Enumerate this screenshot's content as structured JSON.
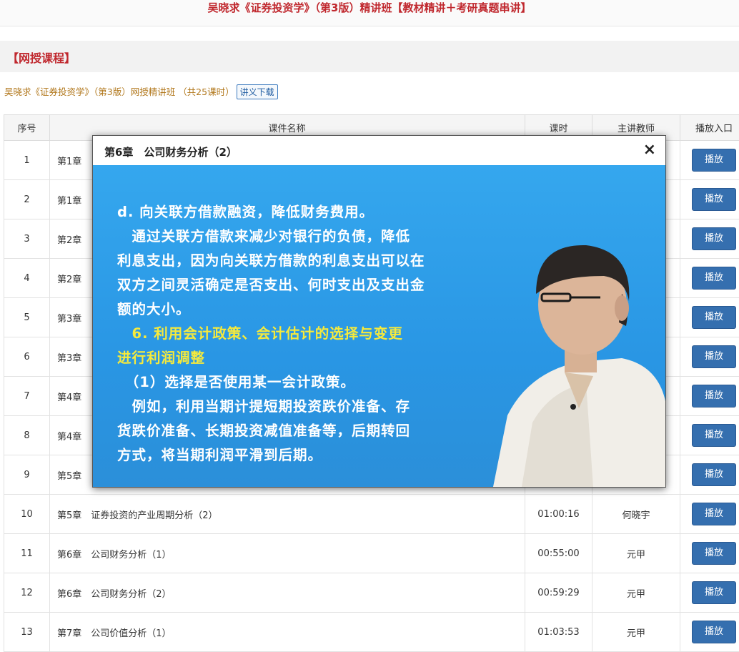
{
  "header": {
    "title": "吴晓求《证券投资学》（第3版）精讲班【教材精讲＋考研真题串讲】"
  },
  "section": {
    "title": "【网授课程】"
  },
  "course": {
    "line": "吴晓求《证券投资学》（第3版）网授精讲班 （共25课时）",
    "download_label": "讲义下载"
  },
  "table": {
    "headers": [
      "序号",
      "课件名称",
      "课时",
      "主讲教师",
      "播放入口"
    ],
    "play_label": "播放",
    "rows": [
      {
        "num": "1",
        "chapter": "第1章",
        "title": "",
        "duration": "",
        "teacher": ""
      },
      {
        "num": "2",
        "chapter": "第1章",
        "title": "",
        "duration": "",
        "teacher": ""
      },
      {
        "num": "3",
        "chapter": "第2章",
        "title": "",
        "duration": "",
        "teacher": ""
      },
      {
        "num": "4",
        "chapter": "第2章",
        "title": "",
        "duration": "",
        "teacher": ""
      },
      {
        "num": "5",
        "chapter": "第3章",
        "title": "",
        "duration": "",
        "teacher": ""
      },
      {
        "num": "6",
        "chapter": "第3章",
        "title": "",
        "duration": "",
        "teacher": ""
      },
      {
        "num": "7",
        "chapter": "第4章",
        "title": "",
        "duration": "",
        "teacher": ""
      },
      {
        "num": "8",
        "chapter": "第4章",
        "title": "",
        "duration": "",
        "teacher": ""
      },
      {
        "num": "9",
        "chapter": "第5章",
        "title": "",
        "duration": "",
        "teacher": ""
      },
      {
        "num": "10",
        "chapter": "第5章",
        "title": "证券投资的产业周期分析（2）",
        "duration": "01:00:16",
        "teacher": "何晓宇"
      },
      {
        "num": "11",
        "chapter": "第6章",
        "title": "公司财务分析（1）",
        "duration": "00:55:00",
        "teacher": "元甲"
      },
      {
        "num": "12",
        "chapter": "第6章",
        "title": "公司财务分析（2）",
        "duration": "00:59:29",
        "teacher": "元甲"
      },
      {
        "num": "13",
        "chapter": "第7章",
        "title": "公司价值分析（1）",
        "duration": "01:03:53",
        "teacher": "元甲"
      }
    ]
  },
  "modal": {
    "title": "第6章　公司财务分析（2）",
    "close_label": "×",
    "slide_lines": [
      "d. 向关联方借款融资，降低财务费用。",
      "　通过关联方借款来减少对银行的负债，降低",
      "利息支出，因为向关联方借款的利息支出可以在",
      "双方之间灵活确定是否支出、何时支出及支出金",
      "额的大小。",
      "　6. 利用会计政策、会计估计的选择与变更",
      "进行利润调整",
      "　（1）选择是否使用某一会计政策。",
      "　例如，利用当期计提短期投资跌价准备、存",
      "货跌价准备、长期投资减值准备等，后期转回",
      "方式，将当期利润平滑到后期。"
    ]
  },
  "colors": {
    "accent_red": "#c0282e",
    "play_button": "#356faf",
    "video_bg": "#2f9ce8",
    "highlight_yellow": "#f6ea3c"
  }
}
